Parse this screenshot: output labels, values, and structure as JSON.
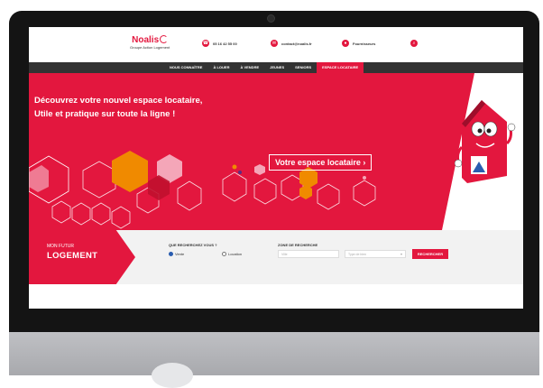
{
  "header": {
    "logo_name": "Noalis",
    "logo_sub": "Groupe Action Logement",
    "phone": "05 16 42 55 00",
    "email": "contact@noalis.fr",
    "suppliers": "Fournisseurs"
  },
  "nav": {
    "items": [
      "NOUS CONNAÎTRE",
      "À LOUER",
      "À VENDRE",
      "JEUNES",
      "SENIORS",
      "ESPACE LOCATAIRE"
    ]
  },
  "hero": {
    "line1": "Découvrez votre nouvel espace locataire,",
    "line2": "Utile et pratique sur toute la ligne !",
    "cta": "Votre espace locataire ›"
  },
  "search": {
    "small": "MON FUTUR",
    "big": "LOGEMENT",
    "question": "QUE RECHERCHEZ VOUS ?",
    "option_sale": "Vente",
    "option_rent": "Location",
    "zone_title": "ZONE DE RECHERCHE",
    "city_placeholder": "Ville",
    "type_placeholder": "Type de bien",
    "button": "RECHERCHER"
  },
  "colors": {
    "brand_red": "#e3173e",
    "nav_dark": "#333333",
    "hex_orange": "#f08a00",
    "hex_pink": "#f4a6b8"
  },
  "icons": {
    "phone": "phone-icon",
    "email": "mail-icon",
    "suppliers": "user-icon",
    "search": "search-icon",
    "mascot": "house-mascot-illustration"
  }
}
